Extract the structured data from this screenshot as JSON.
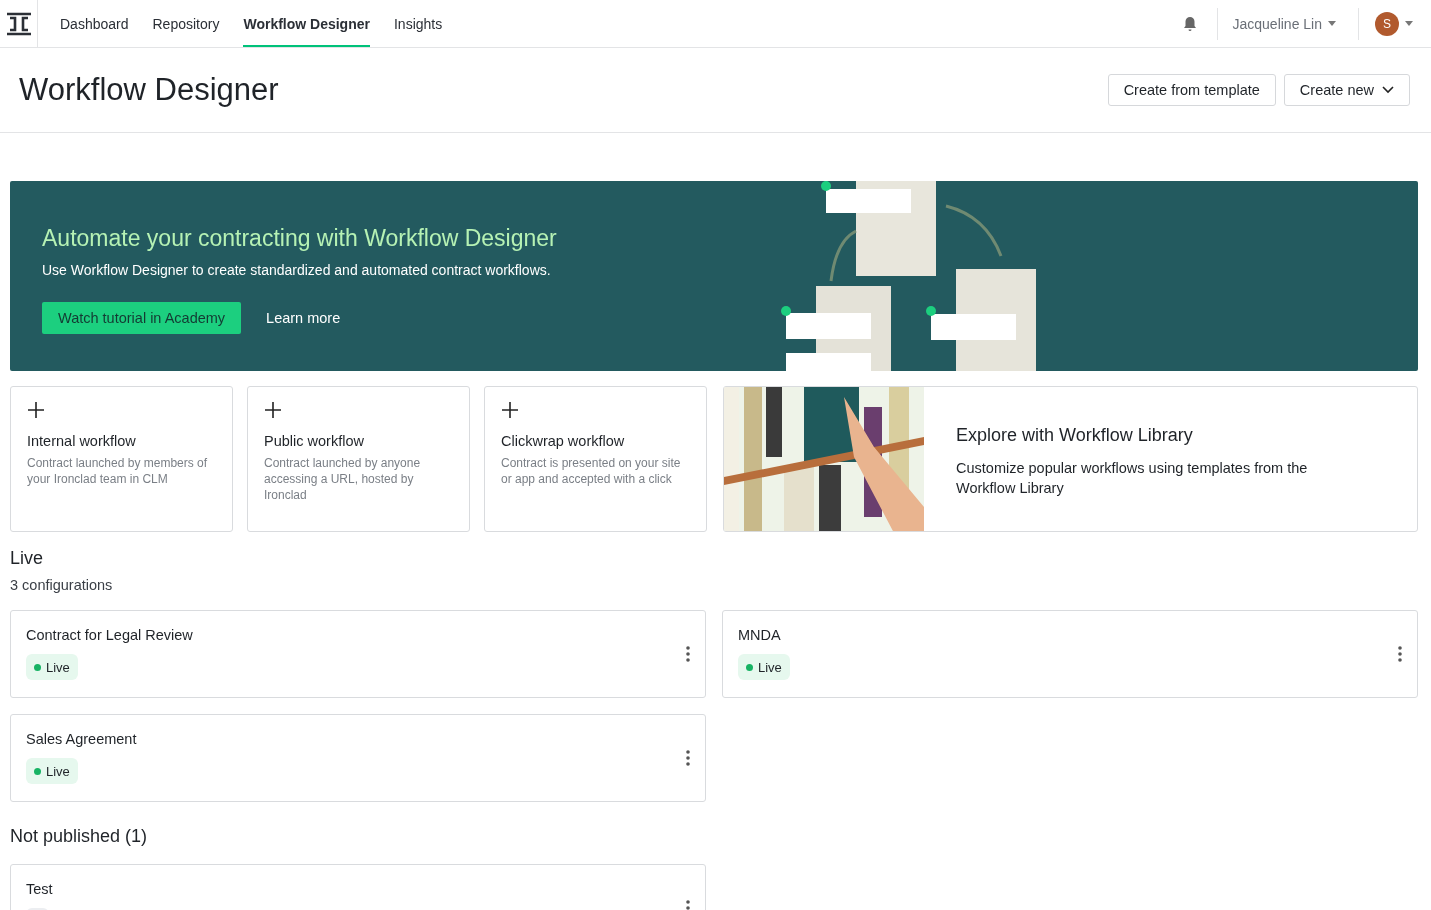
{
  "nav": {
    "tabs": [
      {
        "label": "Dashboard",
        "selected": false
      },
      {
        "label": "Repository",
        "selected": false
      },
      {
        "label": "Workflow Designer",
        "selected": true
      },
      {
        "label": "Insights",
        "selected": false
      }
    ],
    "user": "Jacqueline Lin",
    "avatar": "S"
  },
  "header": {
    "title": "Workflow Designer",
    "buttons": [
      {
        "label": "Create from template",
        "kind": "plain"
      },
      {
        "label": "Create new",
        "kind": "dropdown"
      }
    ]
  },
  "banner": {
    "title": "Automate your contracting with Workflow Designer",
    "text": "Use Workflow Designer to create standardized and automated contract workflows.",
    "primary": "Watch tutorial in Academy",
    "secondary": "Learn more"
  },
  "create_cards": [
    {
      "title": "Internal workflow",
      "text": "Contract launched by members of your Ironclad team in CLM"
    },
    {
      "title": "Public workflow",
      "text": "Contract launched by anyone accessing a URL, hosted by Ironclad"
    },
    {
      "title": "Clickwrap workflow",
      "text": "Contract is presented on your site or app and accepted with a click"
    }
  ],
  "library": {
    "title": "Explore with Workflow Library",
    "text": "Customize popular workflows using templates from the Workflow Library"
  },
  "sections": [
    {
      "title": "Live",
      "subtitle": "3 configurations",
      "items": [
        {
          "name": "Contract for Legal Review",
          "kind": "live",
          "badge": "Live"
        },
        {
          "name": "MNDA",
          "kind": "live",
          "badge": "Live"
        },
        {
          "name": "Sales Agreement",
          "kind": "live",
          "badge": "Live"
        }
      ]
    },
    {
      "title": "Not published (1)",
      "items": [
        {
          "name": "Test",
          "kind": "unpublished"
        }
      ]
    }
  ]
}
